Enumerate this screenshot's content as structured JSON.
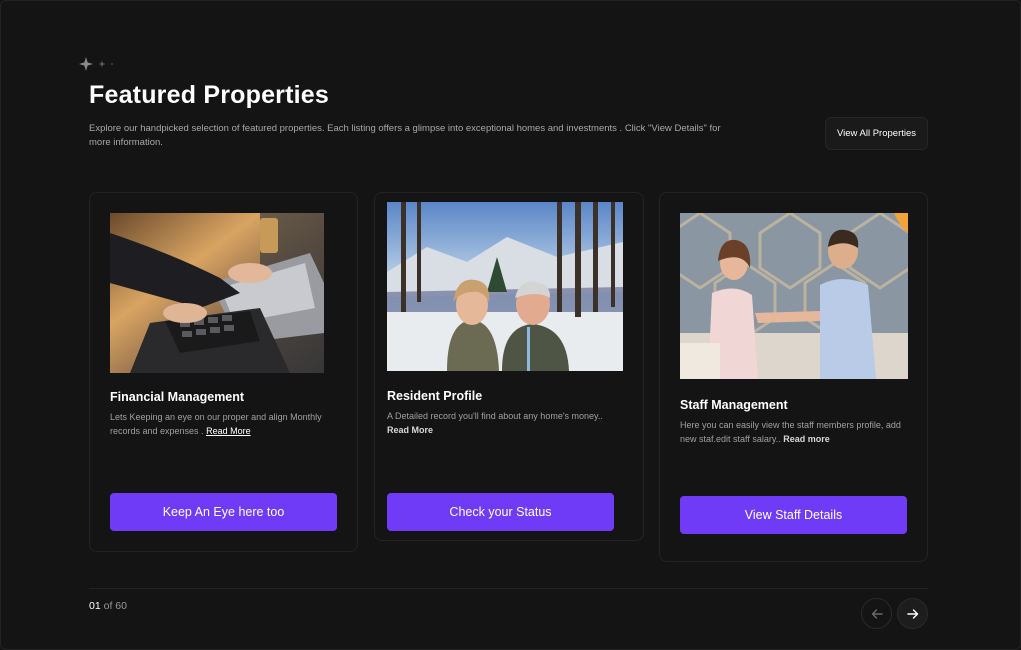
{
  "section": {
    "title": "Featured Properties",
    "description": "Explore our handpicked selection of featured properties. Each listing offers a glimpse into exceptional homes and investments . Click \"View Details\" for more information.",
    "view_all_label": "View All Properties",
    "decor_icon": "sparkles-icon"
  },
  "cards": [
    {
      "title": "Financial Management",
      "text": "Lets Keeping an eye on our proper and align Monthly records  and expenses .",
      "read_more": "Read More",
      "button": "Keep An Eye here too",
      "image": "calculator-laptop-photo"
    },
    {
      "title": "Resident Profile",
      "text": "A Detailed record you'll find about any home's money..",
      "read_more": "Read More",
      "button": "Check your Status",
      "image": "couple-selfie-snow-photo"
    },
    {
      "title": "Staff Management",
      "text": "Here you can easily view the staff members profile, add new staf.edit staff salary..",
      "read_more": "Read more",
      "button": "View Staff Details",
      "image": "office-handshake-photo"
    }
  ],
  "pagination": {
    "current": "01",
    "separator": " of ",
    "total": "60",
    "prev_icon": "arrow-left-icon",
    "next_icon": "arrow-right-icon"
  },
  "colors": {
    "accent": "#703BF7",
    "background": "#141414"
  }
}
